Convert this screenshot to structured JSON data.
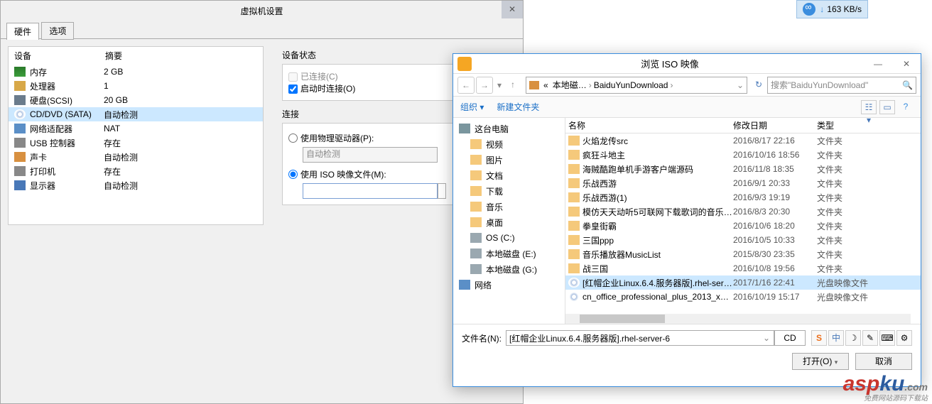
{
  "speed_indicator": {
    "rate": "163 KB/s"
  },
  "vm_settings": {
    "title": "虚拟机设置",
    "tabs": {
      "hardware": "硬件",
      "options": "选项"
    },
    "columns": {
      "device": "设备",
      "summary": "摘要"
    },
    "hardware": [
      {
        "icon": "mem",
        "name": "内存",
        "summary": "2 GB"
      },
      {
        "icon": "cpu",
        "name": "处理器",
        "summary": "1"
      },
      {
        "icon": "disk",
        "name": "硬盘(SCSI)",
        "summary": "20 GB"
      },
      {
        "icon": "cd",
        "name": "CD/DVD (SATA)",
        "summary": "自动检测",
        "selected": true
      },
      {
        "icon": "net",
        "name": "网络适配器",
        "summary": "NAT"
      },
      {
        "icon": "usb",
        "name": "USB 控制器",
        "summary": "存在"
      },
      {
        "icon": "snd",
        "name": "声卡",
        "summary": "自动检测"
      },
      {
        "icon": "prn",
        "name": "打印机",
        "summary": "存在"
      },
      {
        "icon": "dsp",
        "name": "显示器",
        "summary": "自动检测"
      }
    ],
    "device_status": {
      "title": "设备状态",
      "connected": "已连接(C)",
      "connect_on": "启动时连接(O)"
    },
    "connection": {
      "title": "连接",
      "physical": "使用物理驱动器(P):",
      "auto_detect": "自动检测",
      "iso": "使用 ISO 映像文件(M):",
      "iso_value": ""
    }
  },
  "file_dialog": {
    "title": "浏览 ISO 映像",
    "breadcrumb": {
      "root": "本地磁…",
      "folder": "BaiduYunDownload",
      "chev": "›"
    },
    "search_placeholder": "搜索\"BaiduYunDownload\"",
    "toolbar": {
      "organize": "组织 ▾",
      "new_folder": "新建文件夹"
    },
    "headers": {
      "name": "名称",
      "date": "修改日期",
      "type": "类型"
    },
    "tree": [
      {
        "icon": "pc",
        "label": "这台电脑",
        "indent": false
      },
      {
        "icon": "fold",
        "label": "视频",
        "indent": true
      },
      {
        "icon": "fold",
        "label": "图片",
        "indent": true
      },
      {
        "icon": "fold",
        "label": "文档",
        "indent": true
      },
      {
        "icon": "fold",
        "label": "下载",
        "indent": true
      },
      {
        "icon": "fold",
        "label": "音乐",
        "indent": true
      },
      {
        "icon": "fold",
        "label": "桌面",
        "indent": true
      },
      {
        "icon": "dsk",
        "label": "OS (C:)",
        "indent": true
      },
      {
        "icon": "dsk",
        "label": "本地磁盘 (E:)",
        "indent": true
      },
      {
        "icon": "dsk",
        "label": "本地磁盘 (G:)",
        "indent": true
      },
      {
        "icon": "net",
        "label": "网络",
        "indent": false
      }
    ],
    "files": [
      {
        "icon": "fold",
        "name": "火焰龙传src",
        "date": "2016/8/17 22:16",
        "type": "文件夹"
      },
      {
        "icon": "fold",
        "name": "疯狂斗地主",
        "date": "2016/10/16 18:56",
        "type": "文件夹"
      },
      {
        "icon": "fold",
        "name": "海贼酷跑单机手游客户端源码",
        "date": "2016/11/8 18:35",
        "type": "文件夹"
      },
      {
        "icon": "fold",
        "name": "乐战西游",
        "date": "2016/9/1 20:33",
        "type": "文件夹"
      },
      {
        "icon": "fold",
        "name": "乐战西游(1)",
        "date": "2016/9/3 19:19",
        "type": "文件夹"
      },
      {
        "icon": "fold",
        "name": "模仿天天动听5可联网下载歌词的音乐播…",
        "date": "2016/8/3 20:30",
        "type": "文件夹"
      },
      {
        "icon": "fold",
        "name": "拳皇街霸",
        "date": "2016/10/6 18:20",
        "type": "文件夹"
      },
      {
        "icon": "fold",
        "name": "三国ppp",
        "date": "2016/10/5 10:33",
        "type": "文件夹"
      },
      {
        "icon": "fold",
        "name": "音乐播放器MusicList",
        "date": "2015/8/30 23:35",
        "type": "文件夹"
      },
      {
        "icon": "fold",
        "name": "战三国",
        "date": "2016/10/8 19:56",
        "type": "文件夹"
      },
      {
        "icon": "iso",
        "name": "[红帽企业Linux.6.4.服务器版].rhel-serve…",
        "date": "2017/1/16 22:41",
        "type": "光盘映像文件",
        "selected": true
      },
      {
        "icon": "iso",
        "name": "cn_office_professional_plus_2013_x64…",
        "date": "2016/10/19 15:17",
        "type": "光盘映像文件"
      }
    ],
    "filename_label": "文件名(N):",
    "filename_value": "[红帽企业Linux.6.4.服务器版].rhel-server-6",
    "type_filter": "CD",
    "ime": [
      "S",
      "中",
      "",
      "",
      "",
      ""
    ],
    "open": "打开(O)",
    "cancel": "取消"
  },
  "watermark": {
    "a": "asp",
    "b": "ku",
    "c": ".com",
    "sub": "免费网站源码下载站"
  }
}
